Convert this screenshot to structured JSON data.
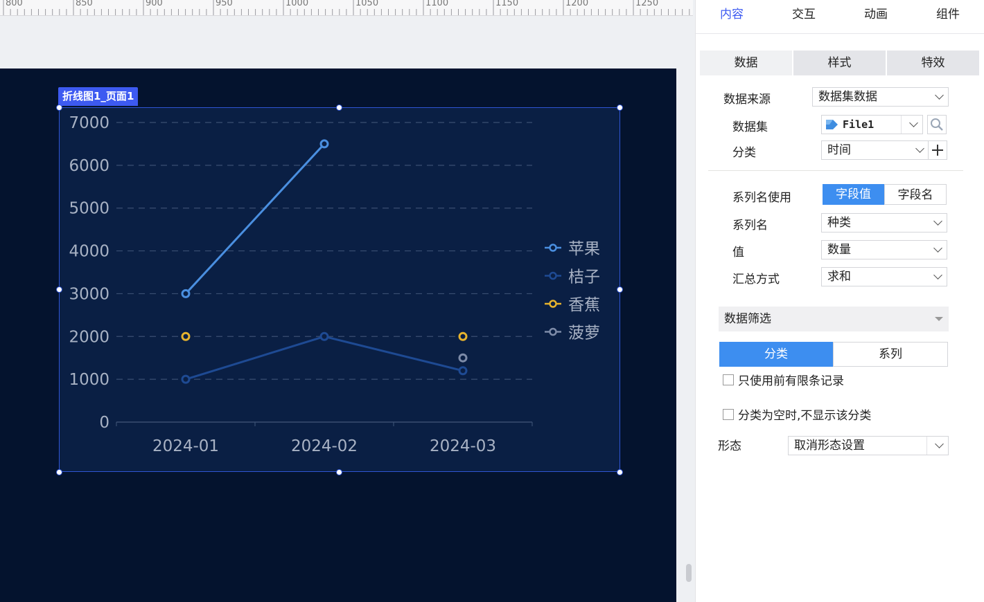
{
  "ruler": {
    "labels": [
      "800",
      "850",
      "900",
      "950",
      "1000",
      "1050",
      "1100",
      "1150",
      "1200",
      "1250"
    ]
  },
  "widget": {
    "tag": "折线图1_页面1"
  },
  "chart_data": {
    "type": "line",
    "x": [
      "2024-01",
      "2024-02",
      "2024-03"
    ],
    "ylim": [
      0,
      7000
    ],
    "yticks": [
      "0",
      "1000",
      "2000",
      "3000",
      "4000",
      "5000",
      "6000",
      "7000"
    ],
    "grid": true,
    "legend": "right",
    "series": [
      {
        "name": "苹果",
        "values": [
          3000,
          6500,
          null
        ],
        "color": "#4a8fe0"
      },
      {
        "name": "桔子",
        "values": [
          1000,
          2000,
          1200
        ],
        "color": "#1e4a93"
      },
      {
        "name": "香蕉",
        "values": [
          2000,
          null,
          2000
        ],
        "color": "#e6b32e"
      },
      {
        "name": "菠萝",
        "values": [
          null,
          null,
          1500
        ],
        "color": "#7d8ba8"
      }
    ]
  },
  "panel": {
    "tabs": [
      "内容",
      "交互",
      "动画",
      "组件"
    ],
    "active_tab": "内容",
    "accent": "#3d5af1",
    "subtabs": [
      "数据",
      "样式",
      "特效"
    ],
    "data_source": {
      "label": "数据来源",
      "value": "数据集数据"
    },
    "dataset": {
      "label": "数据集",
      "value": "File1"
    },
    "category": {
      "label": "分类",
      "value": "时间"
    },
    "series_name_use": {
      "label": "系列名使用",
      "options": [
        "字段值",
        "字段名"
      ],
      "selected": "字段值"
    },
    "series_name": {
      "label": "系列名",
      "value": "种类"
    },
    "value": {
      "label": "值",
      "value": "数量"
    },
    "aggregation": {
      "label": "汇总方式",
      "value": "求和"
    },
    "filter": {
      "header": "数据筛选",
      "tabs": [
        "分类",
        "系列"
      ],
      "active": "分类",
      "limit_records": "只使用前有限条记录",
      "hide_empty": "分类为空时,不显示该分类"
    },
    "form": {
      "label": "形态",
      "value": "取消形态设置"
    }
  }
}
